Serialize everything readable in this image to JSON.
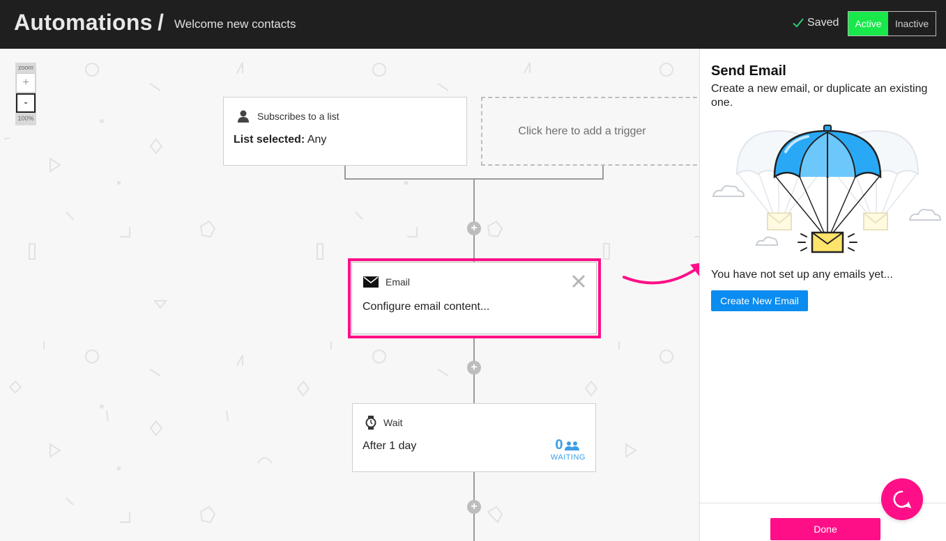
{
  "header": {
    "title": "Automations",
    "separator": "/",
    "subtitle": "Welcome new contacts",
    "saved_label": "Saved",
    "status_active": "Active",
    "status_inactive": "Inactive"
  },
  "zoom": {
    "label": "zoom",
    "zoom_in": "+",
    "zoom_out": "-",
    "level": "100%"
  },
  "trigger": {
    "title": "Subscribes to a list",
    "detail_label": "List selected:",
    "detail_value": "Any"
  },
  "add_trigger": {
    "label": "Click here to add a trigger"
  },
  "email_step": {
    "title": "Email",
    "body": "Configure email content..."
  },
  "wait_step": {
    "title": "Wait",
    "body": "After 1 day",
    "count": "0",
    "count_label": "WAITING"
  },
  "panel": {
    "title": "Send Email",
    "description": "Create a new email, or duplicate an existing one.",
    "empty_message": "You have not set up any emails yet...",
    "create_button": "Create New Email",
    "done_button": "Done"
  },
  "colors": {
    "header_bg": "#1f1f1f",
    "active_green": "#18e84a",
    "highlight_pink": "#ff0f87",
    "primary_blue": "#0a8cf0",
    "waiting_blue": "#3c9ee5"
  },
  "icons": {
    "saved": "check-icon",
    "trigger": "user-icon",
    "email": "envelope-icon",
    "wait": "watch-icon",
    "close": "close-icon",
    "waiting": "people-icon",
    "chat": "chat-bubble-icon"
  }
}
